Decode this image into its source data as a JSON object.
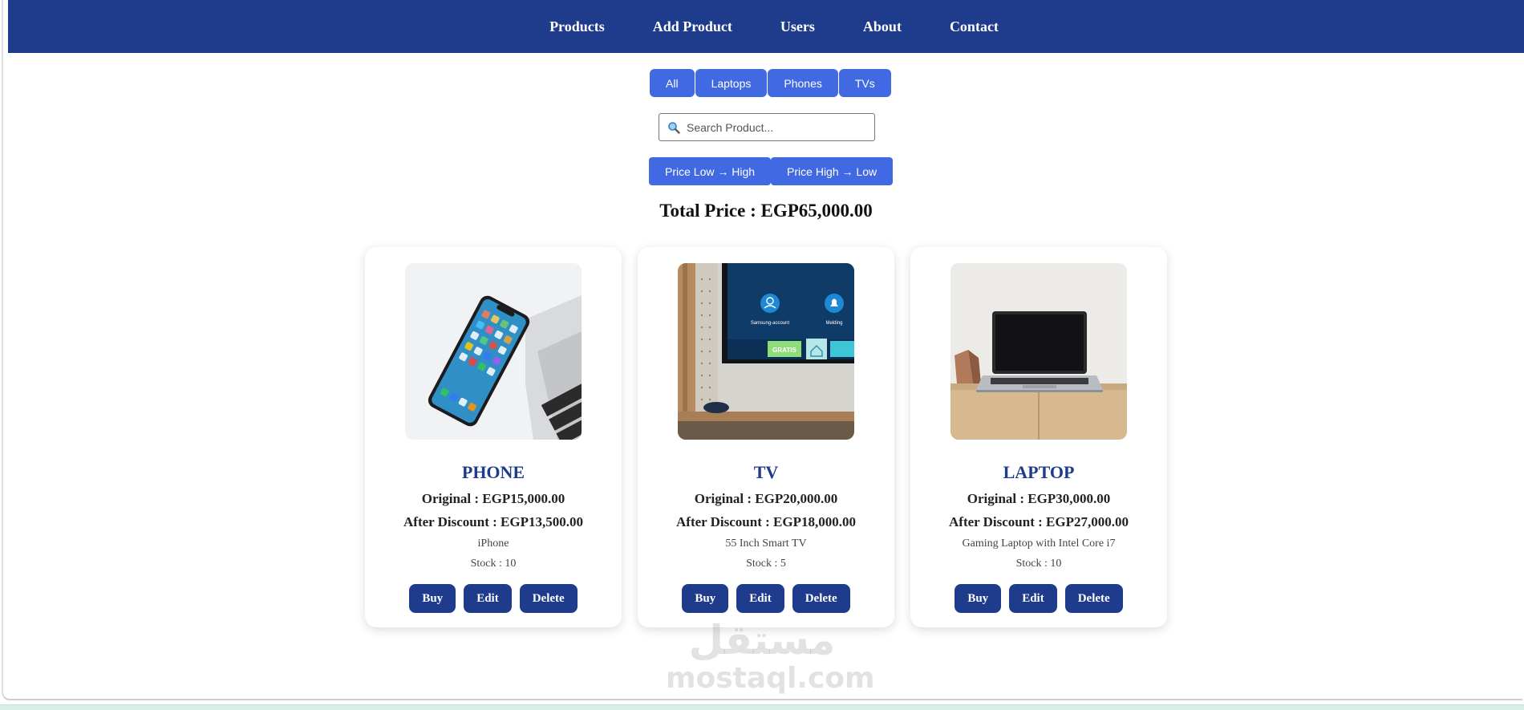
{
  "nav": {
    "items": [
      "Products",
      "Add Product",
      "Users",
      "About",
      "Contact"
    ]
  },
  "filters": [
    "All",
    "Laptops",
    "Phones",
    "TVs"
  ],
  "search": {
    "placeholder": "Search Product..."
  },
  "sort": {
    "low_high": "Price Low → High",
    "high_low": "Price High → Low"
  },
  "total": {
    "label": "Total Price : EGP65,000.00"
  },
  "products": [
    {
      "name": "PHONE",
      "original": "Original : EGP15,000.00",
      "discount": "After Discount : EGP13,500.00",
      "description": "iPhone",
      "stock": "Stock : 10"
    },
    {
      "name": "TV",
      "original": "Original : EGP20,000.00",
      "discount": "After Discount : EGP18,000.00",
      "description": "55 Inch Smart TV",
      "stock": "Stock : 5"
    },
    {
      "name": "LAPTOP",
      "original": "Original : EGP30,000.00",
      "discount": "After Discount : EGP27,000.00",
      "description": "Gaming Laptop with Intel Core i7",
      "stock": "Stock : 10"
    }
  ],
  "card_actions": {
    "buy": "Buy",
    "edit": "Edit",
    "delete": "Delete"
  },
  "tv_screen": {
    "tile1": "Samsung-account",
    "tile2": "Melding",
    "banner": "GRATIS"
  },
  "watermark": {
    "arabic": "مستقل",
    "latin": "mostaql.com"
  },
  "colors": {
    "navbar": "#1f3b8b",
    "accent": "#4169e1",
    "title": "#1f3b8b"
  }
}
